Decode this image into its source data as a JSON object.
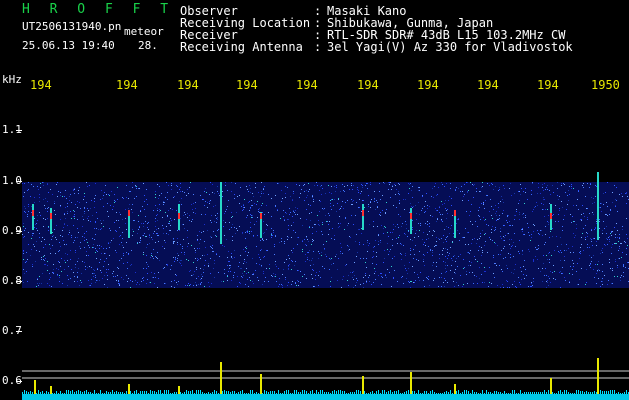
{
  "app": {
    "title": "H R O F F T"
  },
  "file": {
    "name": "UT2506131940.pn",
    "type": "meteor",
    "datetime": "25.06.13 19:40",
    "count": "28."
  },
  "header": [
    {
      "label": "Observer",
      "value": "Masaki Kano"
    },
    {
      "label": "Receiving Location",
      "value": "Shibukawa, Gunma, Japan"
    },
    {
      "label": "Receiver",
      "value": "RTL-SDR SDR# 43dB L15 103.2MHz CW"
    },
    {
      "label": "Receiving Antenna",
      "value": "3el Yagi(V) Az 330 for Vladivostok"
    }
  ],
  "colon": ":",
  "axis": {
    "unit": "kHz",
    "x_ticks": [
      "194",
      "194",
      "194",
      "194",
      "194",
      "194",
      "194",
      "194",
      "194",
      "1950"
    ],
    "y_ticks": [
      "1.1",
      "1.0",
      "0.9",
      "0.8",
      "0.7",
      "0.6"
    ]
  },
  "colors": {
    "title": "#19d24a",
    "xtick": "#e8e800",
    "noise_band": "#0a1a9a",
    "echo": "#ff3030",
    "level_trace": "#e8e800",
    "level_base": "#00e0ff"
  }
}
